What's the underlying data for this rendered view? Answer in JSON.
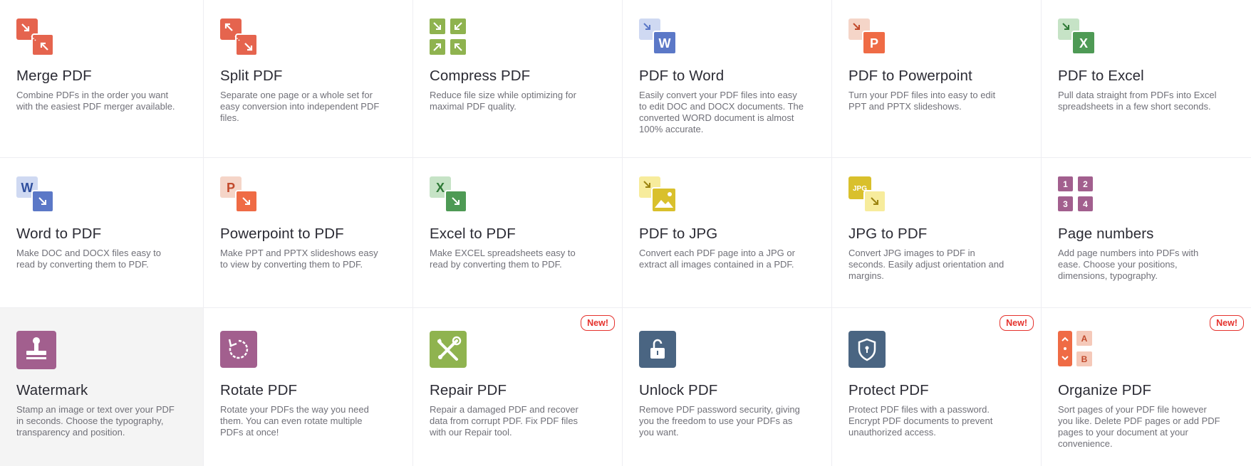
{
  "badge_label": "New!",
  "tools": [
    {
      "title": "Merge PDF",
      "desc": "Combine PDFs in the order you want with the easiest PDF merger available.",
      "icon": "merge-pdf-icon"
    },
    {
      "title": "Split PDF",
      "desc": "Separate one page or a whole set for easy conversion into independent PDF files.",
      "icon": "split-pdf-icon"
    },
    {
      "title": "Compress PDF",
      "desc": "Reduce file size while optimizing for maximal PDF quality.",
      "icon": "compress-pdf-icon"
    },
    {
      "title": "PDF to Word",
      "desc": "Easily convert your PDF files into easy to edit DOC and DOCX documents. The converted WORD document is almost 100% accurate.",
      "icon": "pdf-to-word-icon"
    },
    {
      "title": "PDF to Powerpoint",
      "desc": "Turn your PDF files into easy to edit PPT and PPTX slideshows.",
      "icon": "pdf-to-powerpoint-icon"
    },
    {
      "title": "PDF to Excel",
      "desc": "Pull data straight from PDFs into Excel spreadsheets in a few short seconds.",
      "icon": "pdf-to-excel-icon"
    },
    {
      "title": "Word to PDF",
      "desc": "Make DOC and DOCX files easy to read by converting them to PDF.",
      "icon": "word-to-pdf-icon"
    },
    {
      "title": "Powerpoint to PDF",
      "desc": "Make PPT and PPTX slideshows easy to view by converting them to PDF.",
      "icon": "powerpoint-to-pdf-icon"
    },
    {
      "title": "Excel to PDF",
      "desc": "Make EXCEL spreadsheets easy to read by converting them to PDF.",
      "icon": "excel-to-pdf-icon"
    },
    {
      "title": "PDF to JPG",
      "desc": "Convert each PDF page into a JPG or extract all images contained in a PDF.",
      "icon": "pdf-to-jpg-icon"
    },
    {
      "title": "JPG to PDF",
      "desc": "Convert JPG images to PDF in seconds. Easily adjust orientation and margins.",
      "icon": "jpg-to-pdf-icon"
    },
    {
      "title": "Page numbers",
      "desc": "Add page numbers into PDFs with ease. Choose your positions, dimensions, typography.",
      "icon": "page-numbers-icon"
    },
    {
      "title": "Watermark",
      "desc": "Stamp an image or text over your PDF in seconds. Choose the typography, transparency and position.",
      "icon": "watermark-icon"
    },
    {
      "title": "Rotate PDF",
      "desc": "Rotate your PDFs the way you need them. You can even rotate multiple PDFs at once!",
      "icon": "rotate-pdf-icon"
    },
    {
      "title": "Repair PDF",
      "desc": "Repair a damaged PDF and recover data from corrupt PDF. Fix PDF files with our Repair tool.",
      "icon": "repair-pdf-icon"
    },
    {
      "title": "Unlock PDF",
      "desc": "Remove PDF password security, giving you the freedom to use your PDFs as you want.",
      "icon": "unlock-pdf-icon"
    },
    {
      "title": "Protect PDF",
      "desc": "Protect PDF files with a password. Encrypt PDF documents to prevent unauthorized access.",
      "icon": "protect-pdf-icon"
    },
    {
      "title": "Organize PDF",
      "desc": "Sort pages of your PDF file however you like. Delete PDF pages or add PDF pages to your document at your convenience.",
      "icon": "organize-pdf-icon"
    }
  ],
  "icon_labels": {
    "word": "W",
    "powerpoint": "P",
    "excel": "X",
    "jpg": "JPG",
    "page_numbers": [
      "1",
      "2",
      "3",
      "4"
    ],
    "organize": [
      "A",
      "B"
    ]
  },
  "colors": {
    "merge": "#e5644e",
    "compress": "#8fb34f",
    "word": "#5b78c7",
    "powerpoint": "#ef6b45",
    "excel": "#4e9a55",
    "jpg": "#d9c02c",
    "page_numbers": "#a25f8e",
    "watermark": "#a25f8e",
    "repair": "#8fb34f",
    "lock": "#4a6582",
    "badge": "#e5322d"
  }
}
